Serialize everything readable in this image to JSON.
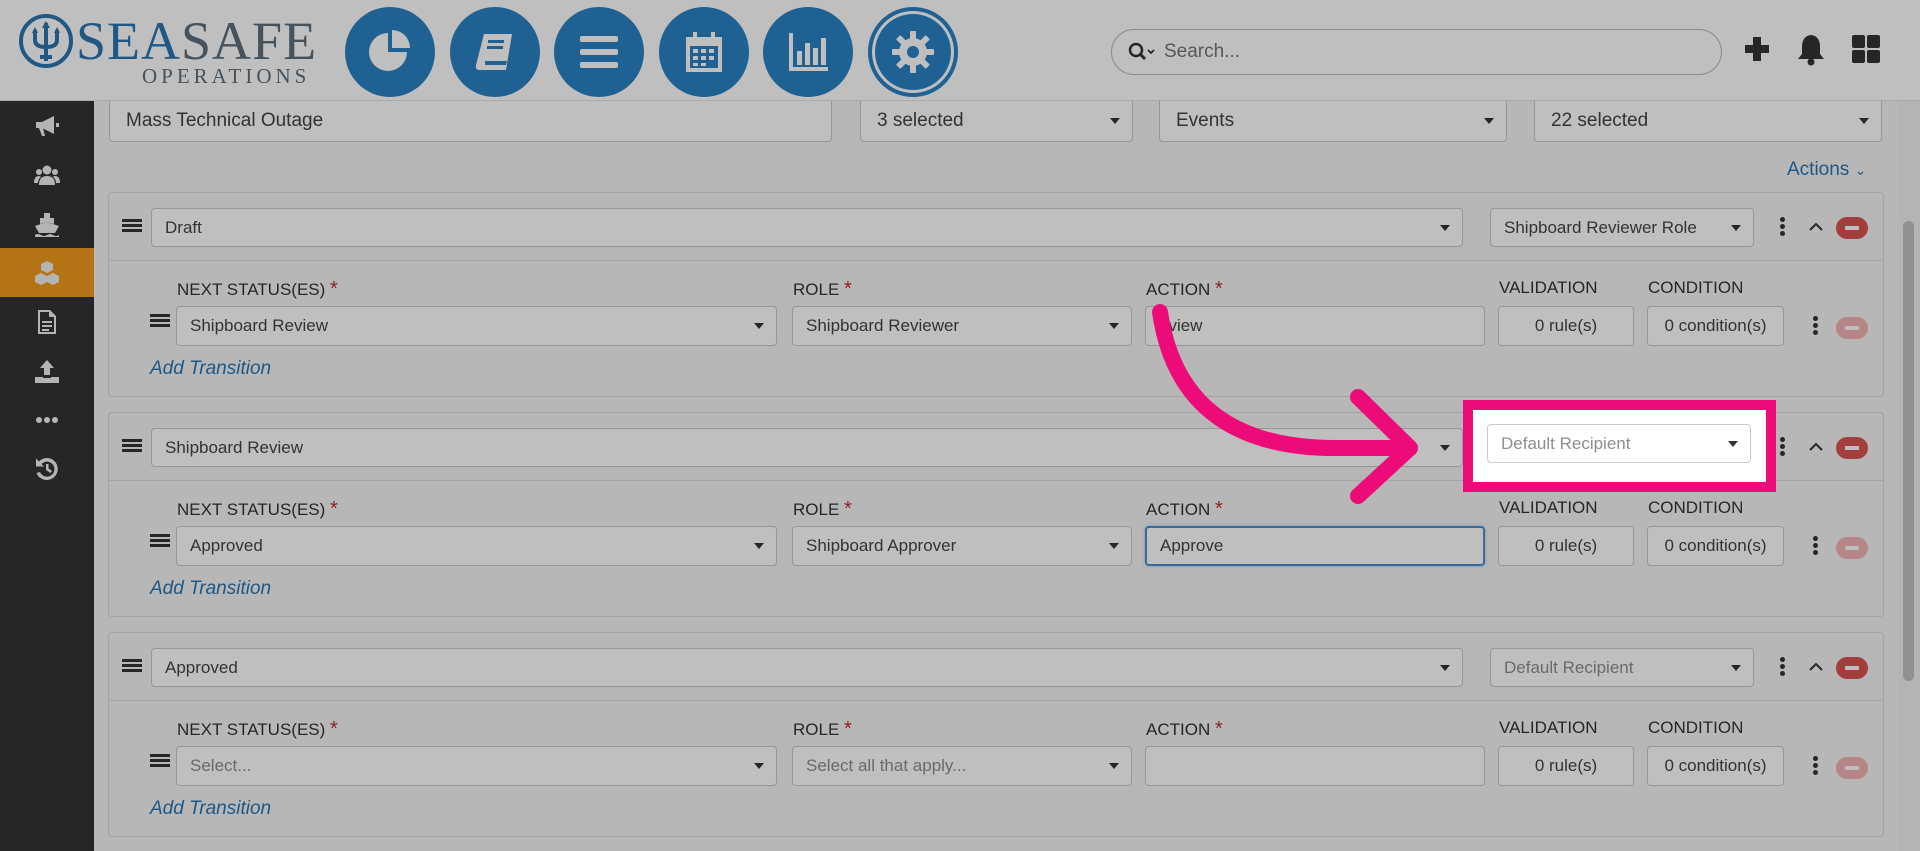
{
  "brand": {
    "name_part1": "SEA",
    "name_part2": "SAFE",
    "tagline": "OPERATIONS"
  },
  "nav": [
    {
      "name": "dashboard-icon"
    },
    {
      "name": "logbook-icon"
    },
    {
      "name": "list-icon"
    },
    {
      "name": "calendar-icon"
    },
    {
      "name": "reports-icon"
    },
    {
      "name": "settings-icon",
      "active": true
    }
  ],
  "search": {
    "placeholder": "Search..."
  },
  "sidebar": [
    {
      "name": "megaphone-icon"
    },
    {
      "name": "users-icon"
    },
    {
      "name": "ship-icon"
    },
    {
      "name": "cubes-icon",
      "active": true
    },
    {
      "name": "document-icon"
    },
    {
      "name": "upload-icon"
    },
    {
      "name": "more-icon"
    },
    {
      "name": "history-icon"
    }
  ],
  "filters": {
    "name": "Mass Technical Outage",
    "selected_a": "3 selected",
    "type": "Events",
    "selected_b": "22 selected"
  },
  "actions_label": "Actions",
  "columns": {
    "next_status": "NEXT STATUS(ES)",
    "role": "ROLE",
    "action": "ACTION",
    "validation": "VALIDATION",
    "condition": "CONDITION",
    "required": "*"
  },
  "add_transition": "Add Transition",
  "statuses": [
    {
      "status": "Draft",
      "recipient": "Shipboard Reviewer Role",
      "next_status": "Shipboard Review",
      "role": "Shipboard Reviewer",
      "action": "eview",
      "validation": "0 rule(s)",
      "condition": "0 condition(s)"
    },
    {
      "status": "Shipboard Review",
      "recipient": "Default Recipient",
      "next_status": "Approved",
      "role": "Shipboard Approver",
      "action": "Approve",
      "validation": "0 rule(s)",
      "condition": "0 condition(s)"
    },
    {
      "status": "Approved",
      "recipient": "Default Recipient",
      "next_status": "Select...",
      "role": "Select all that apply...",
      "action": "",
      "validation": "0 rule(s)",
      "condition": "0 condition(s)"
    }
  ],
  "colors": {
    "brand_blue": "#2b82c4",
    "accent_orange": "#f09a1c",
    "highlight_pink": "#ed0b7a",
    "danger": "#d9534f"
  }
}
